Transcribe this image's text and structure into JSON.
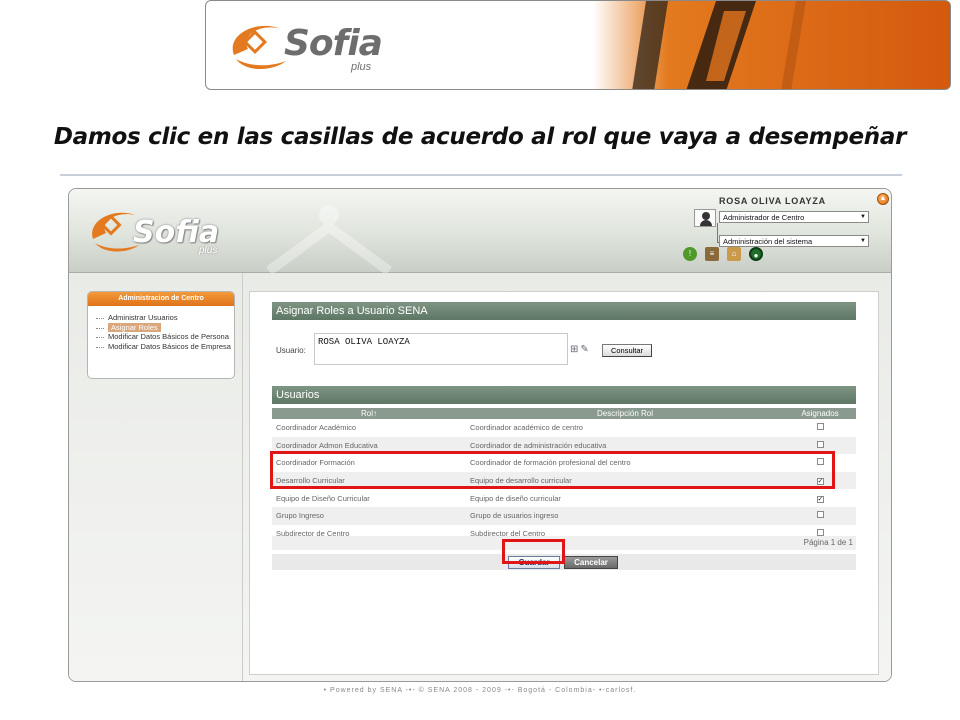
{
  "slide": {
    "title": "Damos clic en las casillas de acuerdo al rol que vaya a desempeñar",
    "logo_text": "Sofia",
    "logo_sub": "plus"
  },
  "app": {
    "logo_text": "Sofia",
    "logo_sub": "plus",
    "user_name": "ROSA OLIVA LOAYZA",
    "role_select": "Administrador de Centro",
    "area_select": "Administración del sistema",
    "header_icons": [
      "info-icon",
      "book-icon",
      "house-icon",
      "power-icon"
    ]
  },
  "menu": {
    "title": "Administracion de Centro",
    "items": [
      {
        "label": "Administrar Usuarios",
        "active": false
      },
      {
        "label": "Asignar Roles",
        "active": true
      },
      {
        "label": "Modificar Datos Básicos de Persona",
        "active": false
      },
      {
        "label": "Modificar Datos Básicos de Empresa",
        "active": false
      }
    ]
  },
  "assign": {
    "section_title": "Asignar Roles a Usuario SENA",
    "user_label": "Usuario:",
    "user_value": "ROSA OLIVA LOAYZA",
    "consult_button": "Consultar"
  },
  "users_table": {
    "section_title": "Usuarios",
    "columns": [
      "Rol↑",
      "Descripción Rol",
      "Asignados"
    ],
    "rows": [
      {
        "rol": "Coordinador Académico",
        "desc": "Coordinador académico de centro",
        "checked": false
      },
      {
        "rol": "Coordinador Admon Educativa",
        "desc": "Coordinador de administración educativa",
        "checked": false
      },
      {
        "rol": "Coordinador Formación",
        "desc": "Coordinador de formación profesional del centro",
        "checked": false
      },
      {
        "rol": "Desarrollo Curricular",
        "desc": "Equipo de desarrollo curricular",
        "checked": true
      },
      {
        "rol": "Equipo de Diseño Curricular",
        "desc": "Equipo de diseño curricular",
        "checked": true
      },
      {
        "rol": "Grupo Ingreso",
        "desc": "Grupo de usuarios ingreso",
        "checked": false
      },
      {
        "rol": "Subdirector de Centro",
        "desc": "Subdirector del Centro",
        "checked": false
      }
    ],
    "pager": "Página 1 de 1"
  },
  "actions": {
    "save": "Guardar",
    "cancel": "Cancelar"
  },
  "footer": "• Powered by SENA -•- © SENA 2008 - 2009 -•- Bogotá - Colombia- •-carlosf.",
  "colors": {
    "highlight": "#e01515",
    "accent_orange": "#e0731a",
    "section_green": "#5e7664"
  }
}
